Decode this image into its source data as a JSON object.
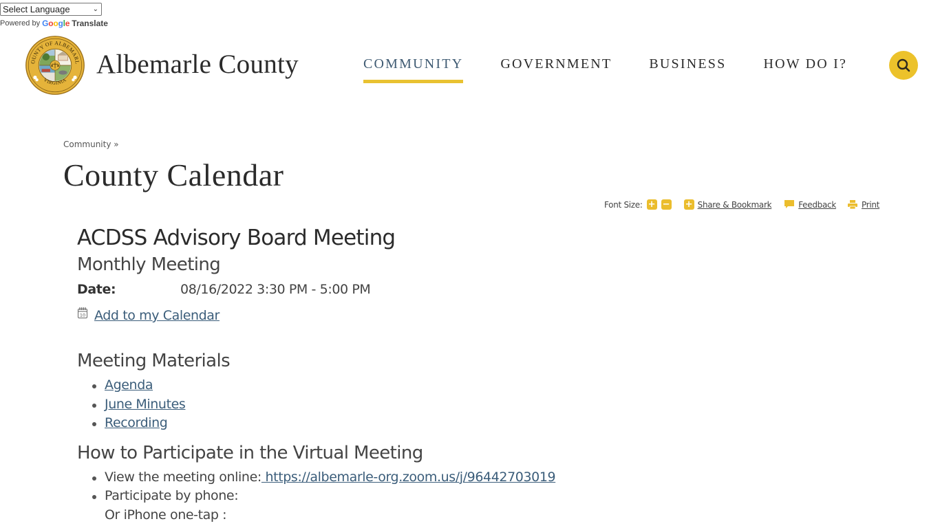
{
  "translate": {
    "select_label": "Select Language",
    "powered_by": "Powered by",
    "google_letters": [
      "G",
      "o",
      "o",
      "g",
      "l",
      "e"
    ],
    "translate_word": "Translate"
  },
  "header": {
    "site_name": "Albemarle County",
    "seal_text_top": "COUNTY OF ALBEMARLE",
    "seal_text_bottom": "VIRGINIA",
    "nav": [
      {
        "label": "COMMUNITY",
        "active": true
      },
      {
        "label": "GOVERNMENT",
        "active": false
      },
      {
        "label": "BUSINESS",
        "active": false
      },
      {
        "label": "HOW DO I?",
        "active": false
      }
    ],
    "search_icon": "search-icon"
  },
  "breadcrumb": {
    "items": [
      "Community"
    ],
    "separator": "»"
  },
  "page_title": "County Calendar",
  "tools": {
    "font_size_label": "Font Size:",
    "increase_symbol": "+",
    "decrease_symbol": "−",
    "share_symbol": "+",
    "share_label": "Share & Bookmark",
    "feedback_label": "Feedback",
    "print_label": "Print"
  },
  "event": {
    "title": "ACDSS Advisory Board Meeting",
    "subtitle": "Monthly Meeting",
    "date_label": "Date:",
    "date_value": "08/16/2022 3:30 PM - 5:00 PM",
    "calendar_icon_day": "10",
    "add_calendar_label": "Add to my Calendar"
  },
  "materials": {
    "heading": "Meeting Materials",
    "links": [
      "Agenda",
      "June Minutes",
      "Recording"
    ]
  },
  "participate": {
    "heading": "How to Participate in the Virtual Meeting",
    "online_label": "View the meeting online:",
    "online_link": " https://albemarle-org.zoom.us/j/96442703019",
    "phone_label": "Participate by phone:",
    "iphone_line": "Or iPhone one-tap :"
  },
  "colors": {
    "accent_gold": "#ecc22b",
    "link_blue": "#3b5d7a",
    "text_dark": "#2b2b2b"
  }
}
